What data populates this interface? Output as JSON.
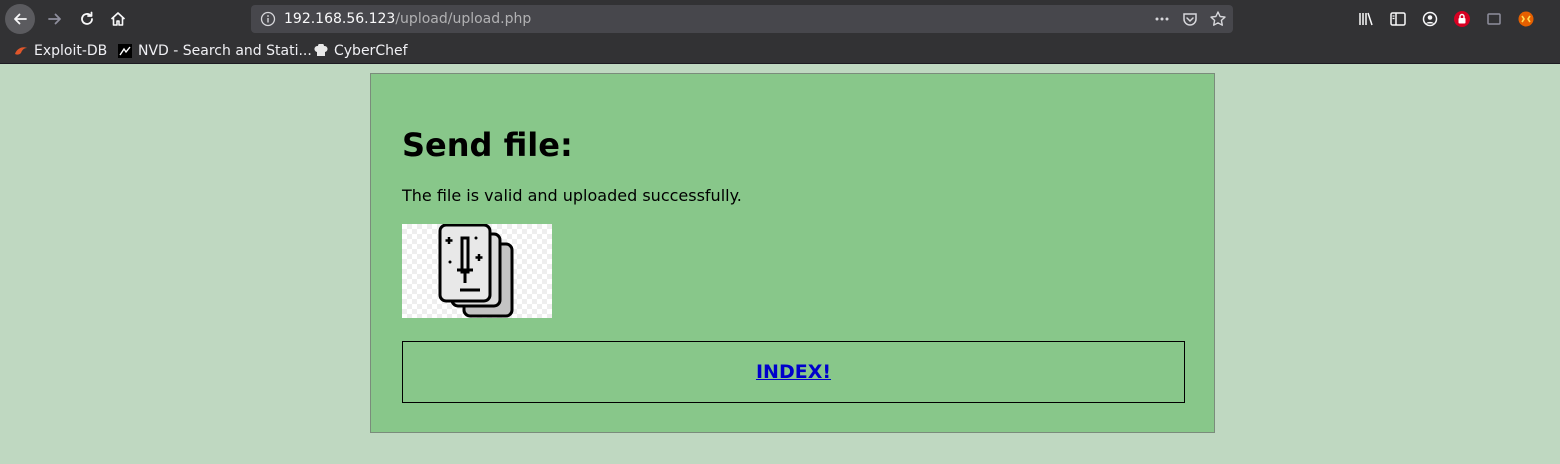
{
  "browser": {
    "url_host": "192.168.56.123",
    "url_path": "/upload/upload.php",
    "bookmarks": [
      {
        "label": "Exploit-DB",
        "icon": "exploitdb-icon"
      },
      {
        "label": "NVD - Search and Stati...",
        "icon": "nvd-icon"
      },
      {
        "label": "CyberChef",
        "icon": "cyberchef-icon"
      }
    ]
  },
  "page": {
    "heading": "Send file:",
    "message": "The file is valid and uploaded successfully.",
    "index_link": "INDEX!",
    "image_icon": "cards-sword-icon"
  },
  "colors": {
    "page_bg": "#bfd8c1",
    "panel_bg": "#88c78a",
    "link": "#0000cc",
    "chrome_bg": "#323234"
  }
}
